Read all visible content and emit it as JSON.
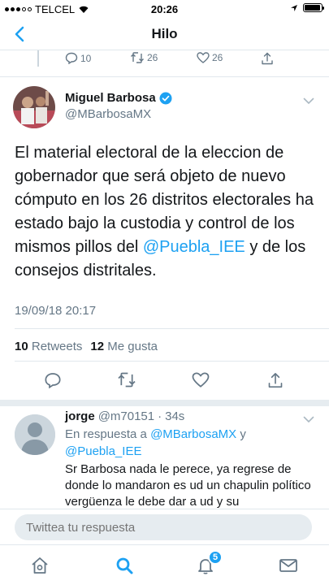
{
  "status_bar": {
    "carrier": "TELCEL",
    "time": "20:26",
    "battery_level": 0.95
  },
  "nav": {
    "title": "Hilo"
  },
  "previous_tweet": {
    "reply_count": "10",
    "retweet_count": "26",
    "like_count": "26"
  },
  "tweet": {
    "author_name": "Miguel Barbosa",
    "author_handle": "@MBarbosaMX",
    "text_before": "El material electoral de la eleccion de gobernador que será objeto de nuevo cómputo en los 26 distritos electorales ha estado bajo la custodia y control de los mismos pillos del ",
    "mention": "@Puebla_IEE",
    "text_after": " y de los consejos distritales.",
    "timestamp": "19/09/18 20:17",
    "retweets_count": "10",
    "retweets_label": "Retweets",
    "likes_count": "12",
    "likes_label": "Me gusta"
  },
  "reply": {
    "name": "jorge",
    "handle": "@m70151",
    "dot": "·",
    "age": "34s",
    "in_reply_prefix": "En respuesta a ",
    "in_reply_mention1": "@MBarbosaMX",
    "in_reply_and": " y",
    "in_reply_mention2": "@Puebla_IEE",
    "body": "Sr Barbosa nada le perece, ya regrese de donde lo mandaron es ud un chapulin político vergüenza le debe dar a ud y su"
  },
  "compose": {
    "placeholder": "Twittea tu respuesta"
  },
  "tab_bar": {
    "notifications_badge": "5"
  },
  "colors": {
    "accent": "#1da1f2",
    "text": "#14171a",
    "secondary": "#657786",
    "verified": "#1da1f2"
  }
}
